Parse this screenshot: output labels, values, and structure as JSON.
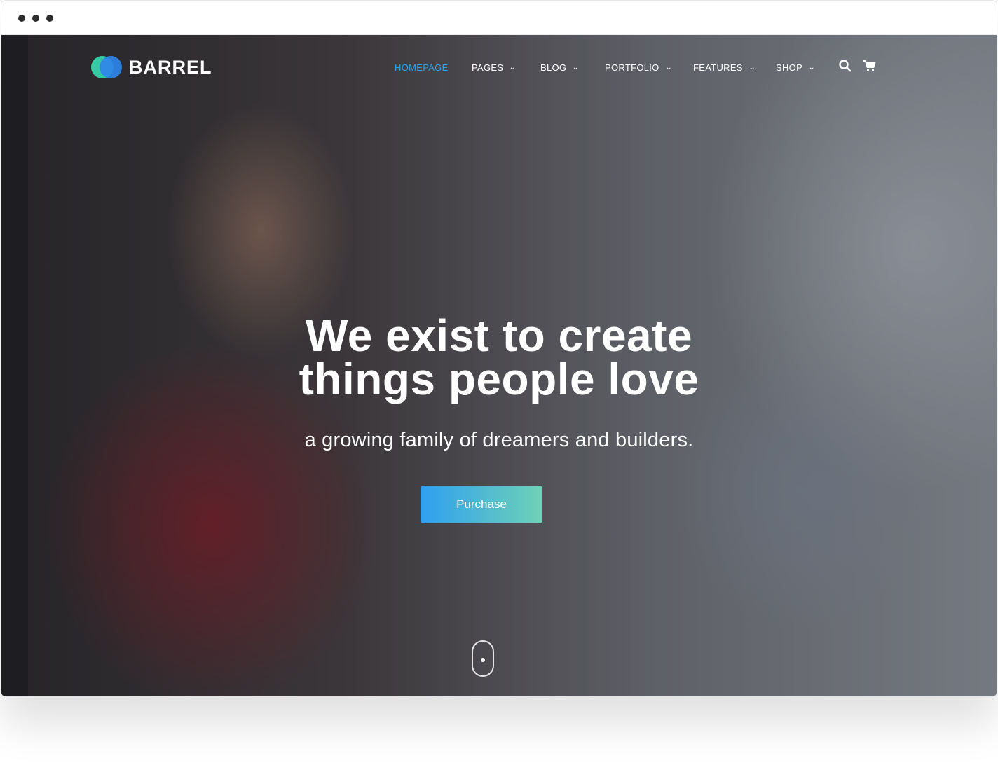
{
  "brand": {
    "name": "BARREL"
  },
  "nav": {
    "items": [
      {
        "label": "HOMEPAGE",
        "active": true,
        "has_dropdown": false
      },
      {
        "label": "PAGES",
        "active": false,
        "has_dropdown": true
      },
      {
        "label": "BLOG",
        "active": false,
        "has_dropdown": true
      },
      {
        "label": "PORTFOLIO",
        "active": false,
        "has_dropdown": true
      },
      {
        "label": "FEATURES",
        "active": false,
        "has_dropdown": true
      },
      {
        "label": "SHOP",
        "active": false,
        "has_dropdown": true
      }
    ],
    "dropdown_glyph": "⌄",
    "icons": [
      "search-icon",
      "cart-icon"
    ]
  },
  "hero": {
    "headline_line1": "We exist to create",
    "headline_line2": "things people love",
    "subhead": "a growing family of dreamers and builders.",
    "cta_label": "Purchase"
  },
  "colors": {
    "accent_active": "#2f9fe6",
    "cta_gradient_start": "#2f9ff0",
    "cta_gradient_end": "#6fd2b6",
    "logo_teal": "#36c9a2",
    "logo_blue": "#2f86e8"
  }
}
